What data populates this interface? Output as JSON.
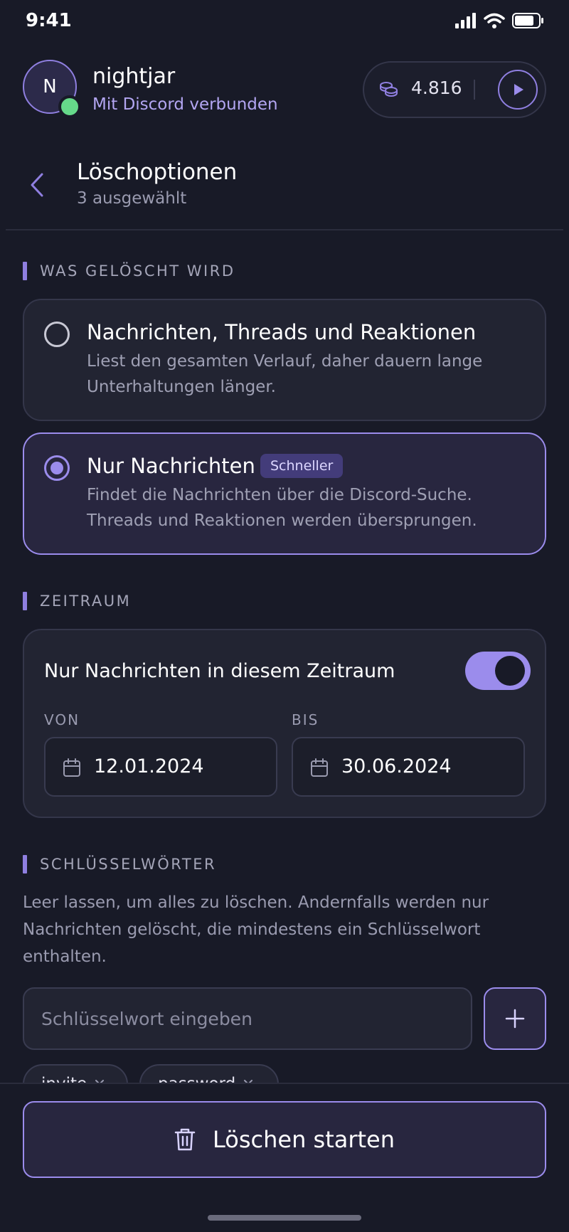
{
  "status_bar": {
    "time": "9:41"
  },
  "account": {
    "avatar_initial": "N",
    "username": "nightjar",
    "connection_status": "Mit Discord verbunden",
    "credits": "4.816"
  },
  "header": {
    "title": "Löschoptionen",
    "subtitle": "3 ausgewählt"
  },
  "deletion_scope": {
    "section_label": "WAS GELÖSCHT WIRD",
    "options": [
      {
        "title": "Nachrichten, Threads und Reaktionen",
        "description": "Liest den gesamten Verlauf, daher dauern lange Unterhaltungen länger.",
        "selected": false
      },
      {
        "title": "Nur Nachrichten",
        "badge": "Schneller",
        "description": "Findet die Nachrichten über die Discord-Suche. Threads und Reaktionen werden übersprungen.",
        "selected": true
      }
    ]
  },
  "time_range": {
    "section_label": "ZEITRAUM",
    "toggle_label": "Nur Nachrichten in diesem Zeitraum",
    "toggle_on": true,
    "from_label": "VON",
    "from_value": "12.01.2024",
    "to_label": "BIS",
    "to_value": "30.06.2024"
  },
  "keywords": {
    "section_label": "SCHLÜSSELWÖRTER",
    "help": "Leer lassen, um alles zu löschen. Andernfalls werden nur Nachrichten gelöscht, die mindestens ein Schlüsselwort enthalten.",
    "placeholder": "Schlüsselwort eingeben",
    "chips": [
      "invite",
      "password"
    ]
  },
  "action": {
    "start_label": "Löschen starten"
  },
  "colors": {
    "background": "#181a27",
    "accent": "#9b8cec",
    "online": "#66d98a"
  }
}
